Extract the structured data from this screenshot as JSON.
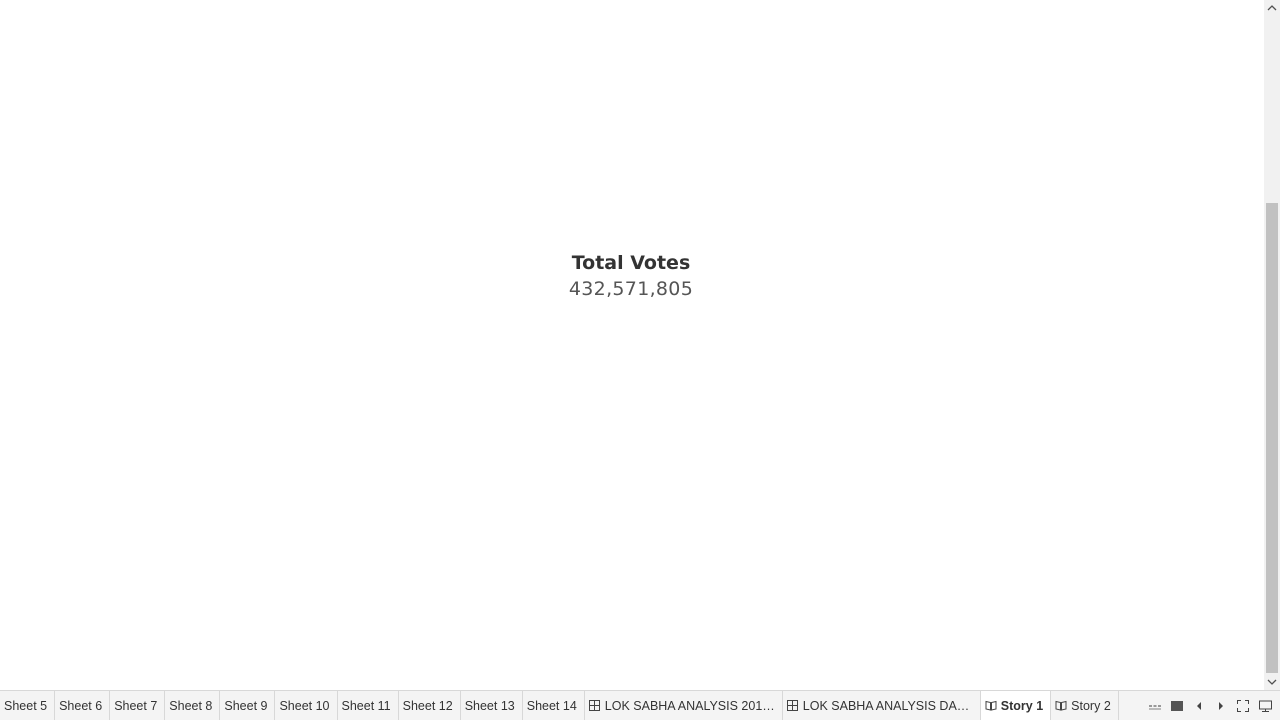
{
  "kpi": {
    "title": "Total Votes",
    "value": "432,571,805"
  },
  "tabs": [
    {
      "label": "Sheet 5",
      "type": "sheet"
    },
    {
      "label": "Sheet 6",
      "type": "sheet"
    },
    {
      "label": "Sheet 7",
      "type": "sheet"
    },
    {
      "label": "Sheet 8",
      "type": "sheet"
    },
    {
      "label": "Sheet 9",
      "type": "sheet"
    },
    {
      "label": "Sheet 10",
      "type": "sheet"
    },
    {
      "label": "Sheet 11",
      "type": "sheet"
    },
    {
      "label": "Sheet 12",
      "type": "sheet"
    },
    {
      "label": "Sheet 13",
      "type": "sheet"
    },
    {
      "label": "Sheet 14",
      "type": "sheet"
    },
    {
      "label": "LOK SABHA ANALYSIS 2019...",
      "type": "dashboard",
      "icon": "dashboard-grid-icon"
    },
    {
      "label": "LOK SABHA ANALYSIS DAH...",
      "type": "dashboard",
      "icon": "dashboard-grid-icon"
    },
    {
      "label": "Story 1",
      "type": "story",
      "icon": "story-book-icon",
      "active": true
    },
    {
      "label": "Story 2",
      "type": "story",
      "icon": "story-book-icon"
    }
  ],
  "controls": [
    {
      "name": "show-filmstrip-icon"
    },
    {
      "name": "show-tabs-icon"
    },
    {
      "name": "scroll-tabs-left-icon"
    },
    {
      "name": "scroll-tabs-right-icon"
    },
    {
      "name": "fullscreen-icon"
    },
    {
      "name": "presentation-mode-icon"
    }
  ],
  "colors": {
    "background": "#ffffff",
    "tabbar": "#f4f4f4",
    "text": "#333333",
    "scrollbar_thumb": "#c1c1c1"
  }
}
